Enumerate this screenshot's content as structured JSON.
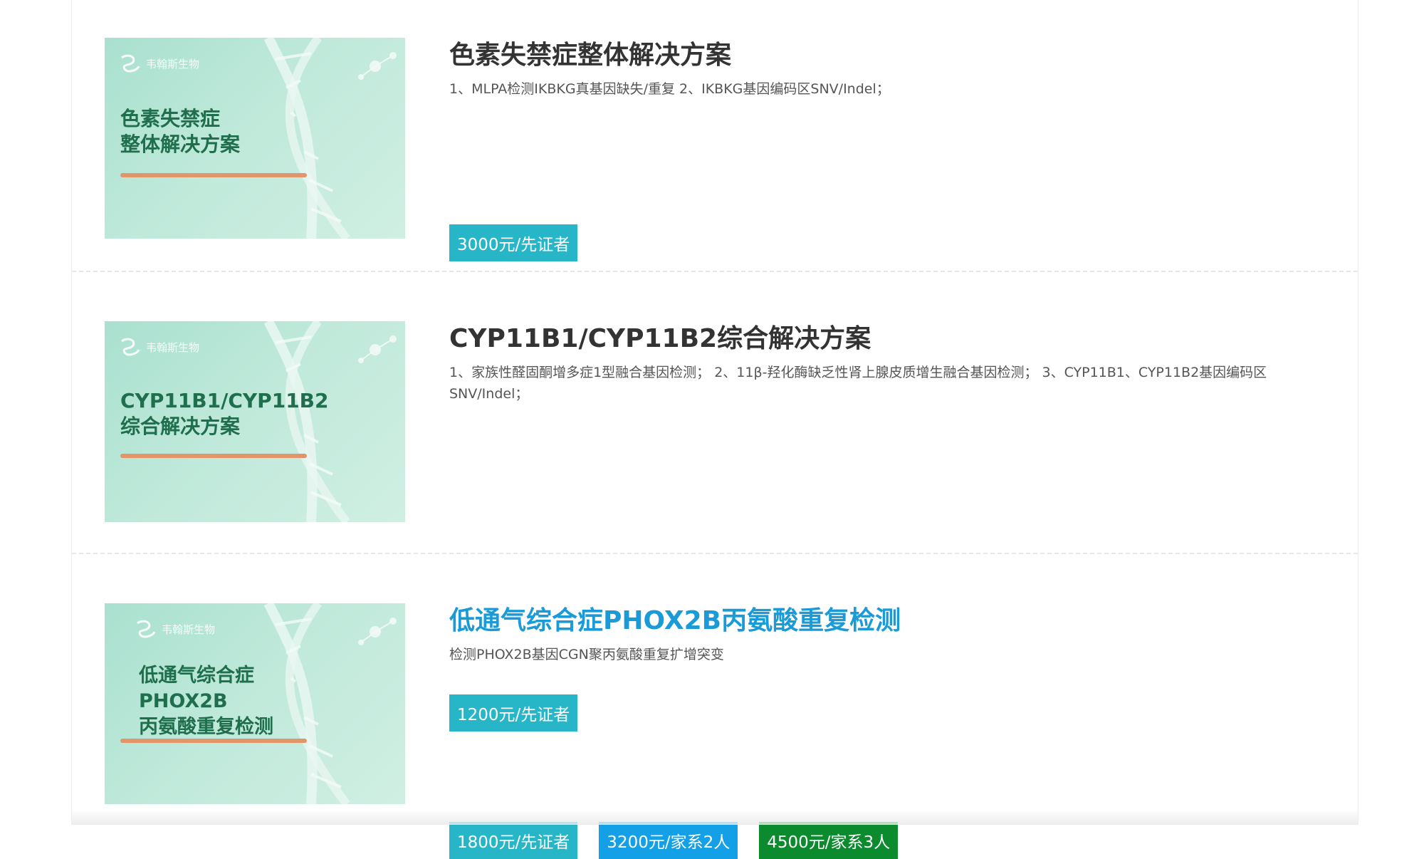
{
  "items": [
    {
      "title": "色素失禁症整体解决方案",
      "description": "1、MLPA检测IKBKG真基因缺失/重复 2、IKBKG基因编码区SNV/Indel；",
      "thumb": {
        "logo_text": "韦翰斯生物",
        "title": "色素失禁症\n整体解决方案"
      },
      "prices": [
        {
          "label": "3000元/先证者",
          "color": "#27b5c8"
        }
      ]
    },
    {
      "title": "CYP11B1/CYP11B2综合解决方案",
      "description": "1、家族性醛固酮增多症1型融合基因检测； 2、11β-羟化酶缺乏性肾上腺皮质增生融合基因检测； 3、CYP11B1、CYP11B2基因编码区SNV/Indel；",
      "thumb": {
        "logo_text": "韦翰斯生物",
        "title": "CYP11B1/CYP11B2\n综合解决方案"
      },
      "prices": [
        {
          "label": "1800元/先证者",
          "color": "#27b5c8"
        },
        {
          "label": "3200元/家系2人",
          "color": "#13a0e6"
        },
        {
          "label": "4500元/家系3人",
          "color": "#0b8a2e"
        }
      ]
    },
    {
      "title": "低通气综合症PHOX2B丙氨酸重复检测",
      "description": "检测PHOX2B基因CGN聚丙氨酸重复扩增突变",
      "thumb": {
        "logo_text": "韦翰斯生物",
        "title": "低通气综合症\nPHOX2B\n丙氨酸重复检测"
      },
      "prices": [
        {
          "label": "1200元/先证者",
          "color": "#27b5c8"
        }
      ]
    }
  ]
}
